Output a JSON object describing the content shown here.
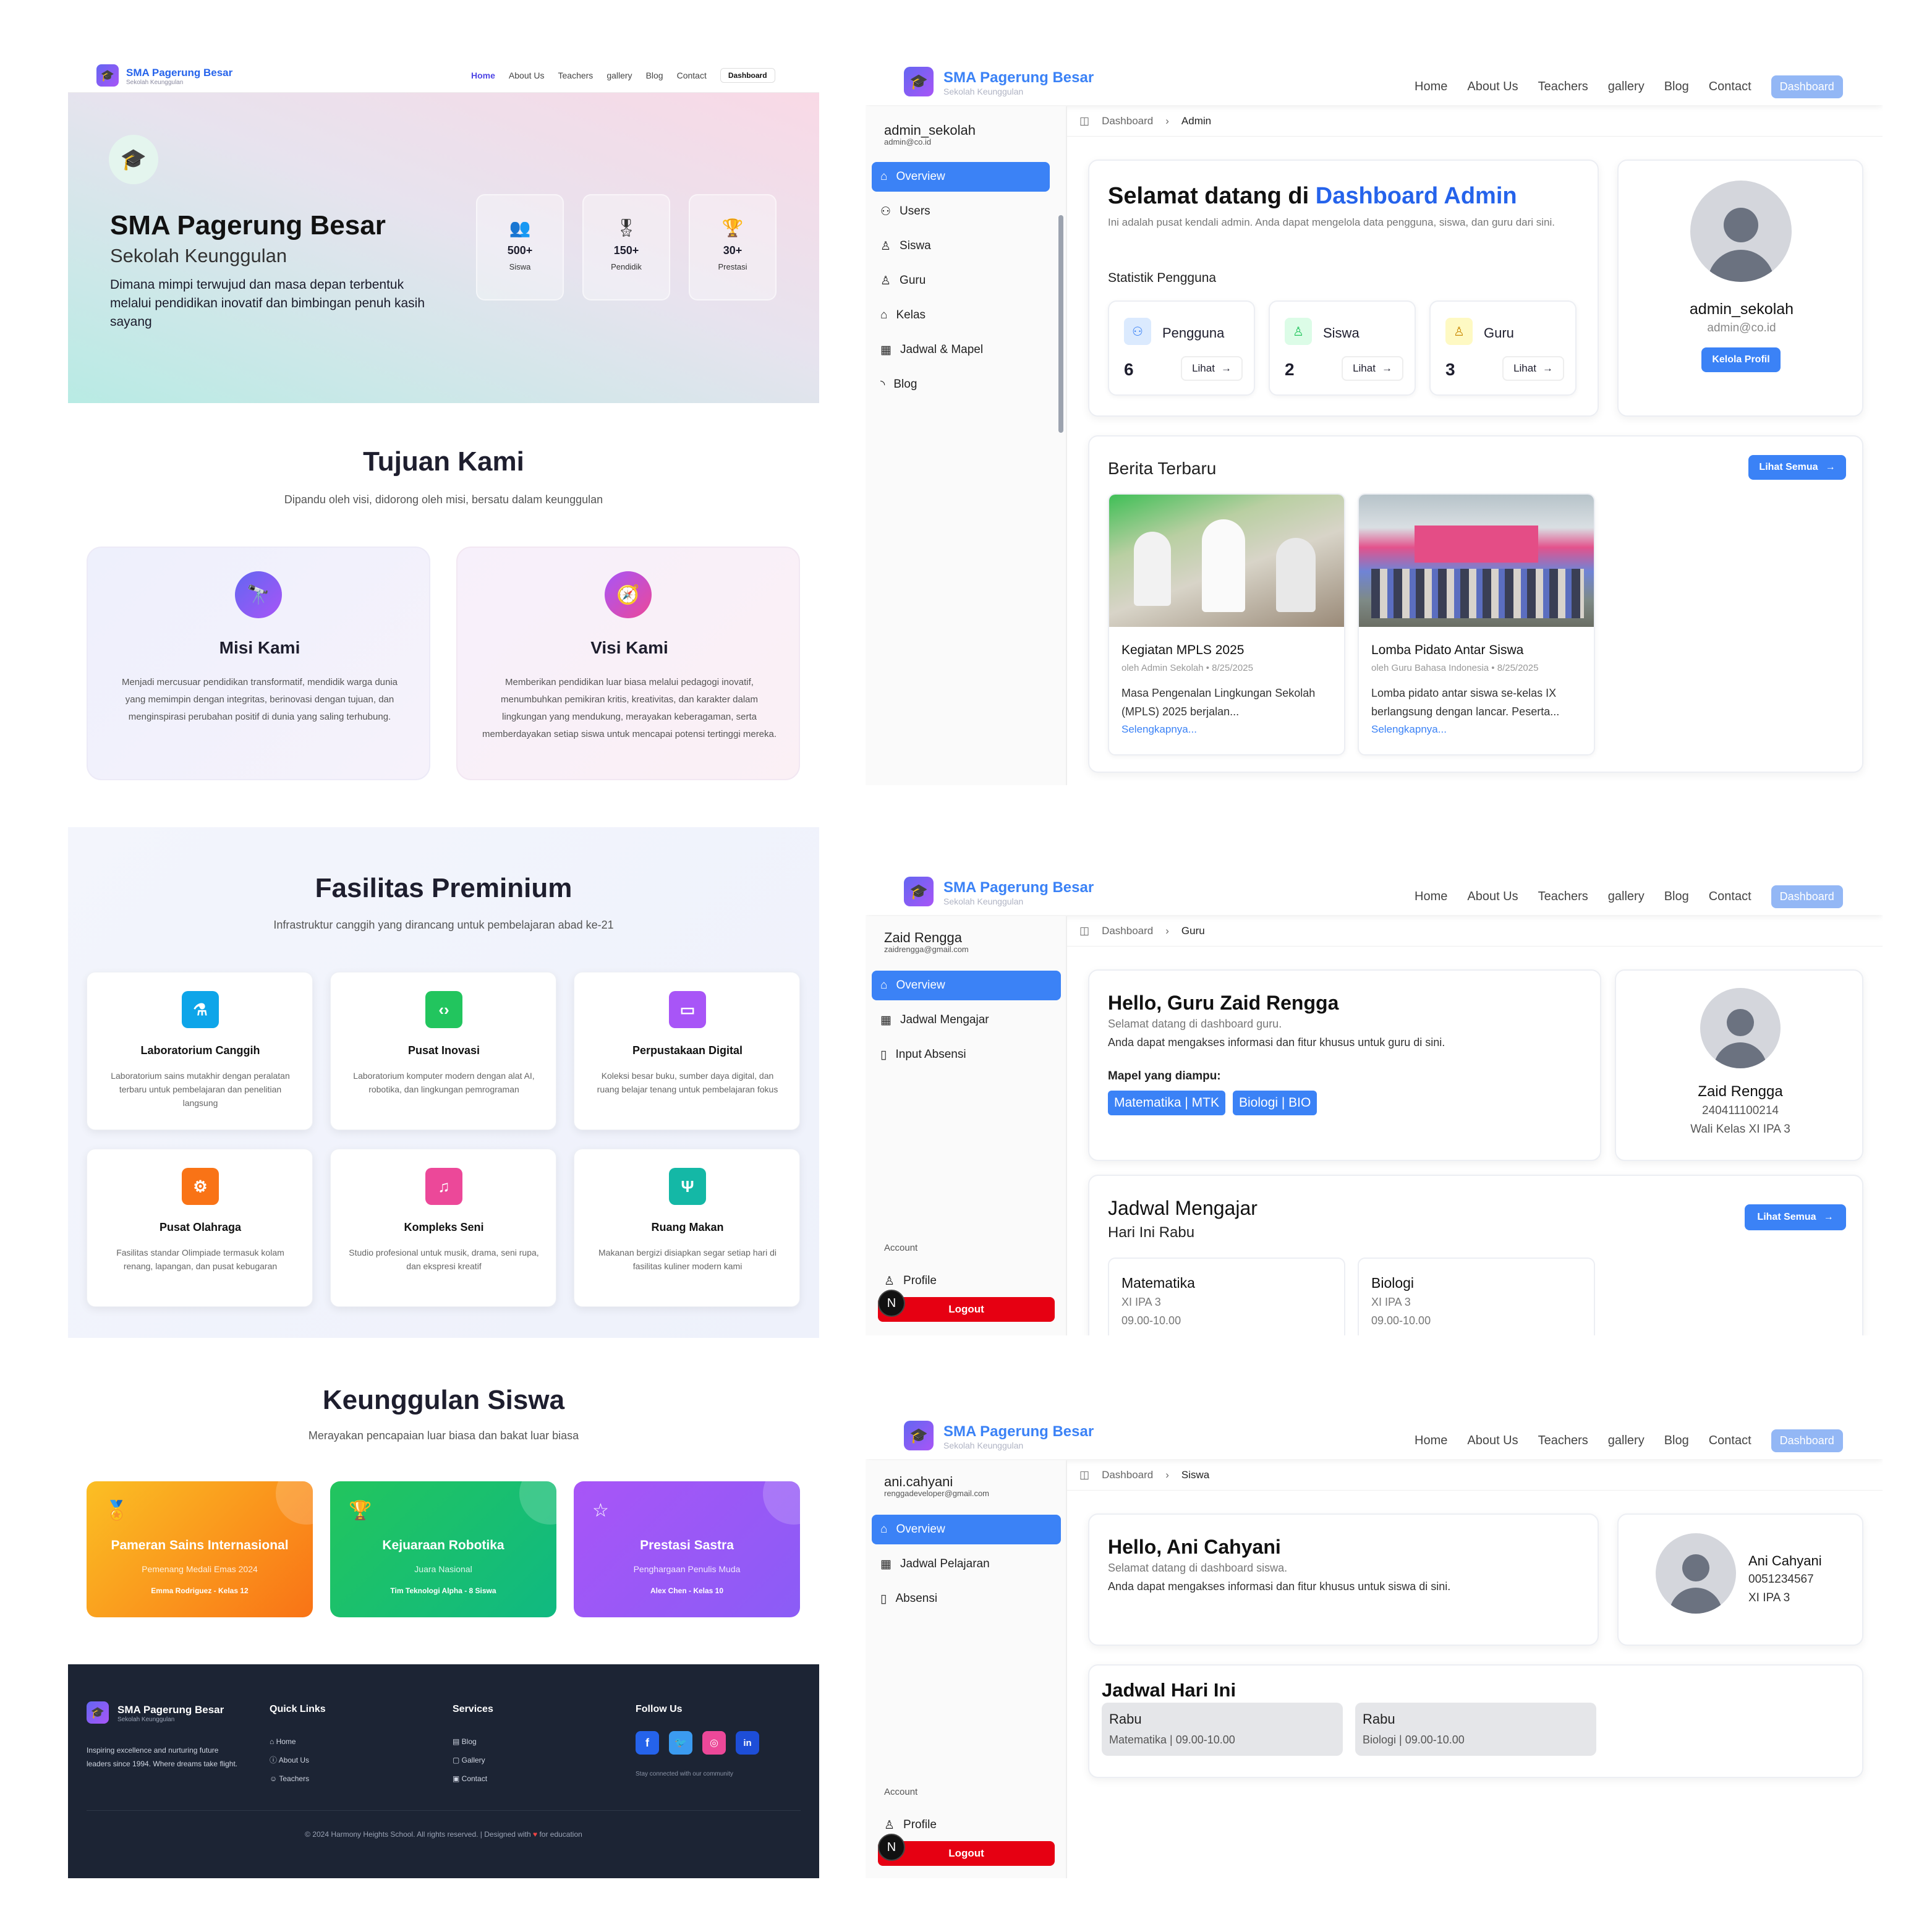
{
  "brand": {
    "name": "SMA Pagerung Besar",
    "tagline": "Sekolah Keunggulan"
  },
  "nav": {
    "home": "Home",
    "about": "About Us",
    "teachers": "Teachers",
    "gallery": "gallery",
    "blog": "Blog",
    "contact": "Contact",
    "dashboard": "Dashboard"
  },
  "landing": {
    "hero": {
      "title": "SMA Pagerung Besar",
      "subtitle": "Sekolah Keunggulan",
      "desc": "Dimana mimpi terwujud dan masa depan terbentuk melalui pendidikan inovatif dan bimbingan penuh kasih sayang",
      "stats": [
        {
          "value": "500+",
          "label": "Siswa",
          "icon": "users-icon"
        },
        {
          "value": "150+",
          "label": "Pendidik",
          "icon": "award-icon"
        },
        {
          "value": "30+",
          "label": "Prestasi",
          "icon": "trophy-icon"
        }
      ]
    },
    "goals": {
      "title": "Tujuan Kami",
      "subtitle": "Dipandu oleh visi, didorong oleh misi, bersatu dalam keunggulan",
      "cards": [
        {
          "title": "Misi Kami",
          "text": "Menjadi mercusuar pendidikan transformatif, mendidik warga dunia yang memimpin dengan integritas, berinovasi dengan tujuan, dan menginspirasi perubahan positif di dunia yang saling terhubung."
        },
        {
          "title": "Visi Kami",
          "text": "Memberikan pendidikan luar biasa melalui pedagogi inovatif, menumbuhkan pemikiran kritis, kreativitas, dan karakter dalam lingkungan yang mendukung, merayakan keberagaman, serta memberdayakan setiap siswa untuk mencapai potensi tertinggi mereka."
        }
      ]
    },
    "facilities": {
      "title": "Fasilitas Preminium",
      "subtitle": "Infrastruktur canggih yang dirancang untuk pembelajaran abad ke-21",
      "items": [
        {
          "title": "Laboratorium Canggih",
          "text": "Laboratorium sains mutakhir dengan peralatan terbaru untuk pembelajaran dan penelitian langsung",
          "color": "#0ea5e9",
          "glyph": "⚗"
        },
        {
          "title": "Pusat Inovasi",
          "text": "Laboratorium komputer modern dengan alat AI, robotika, dan lingkungan pemrograman",
          "color": "#22c55e",
          "glyph": "‹›"
        },
        {
          "title": "Perpustakaan Digital",
          "text": "Koleksi besar buku, sumber daya digital, dan ruang belajar tenang untuk pembelajaran fokus",
          "color": "#a855f7",
          "glyph": "▭"
        },
        {
          "title": "Pusat Olahraga",
          "text": "Fasilitas standar Olimpiade termasuk kolam renang, lapangan, dan pusat kebugaran",
          "color": "#f97316",
          "glyph": "⚙"
        },
        {
          "title": "Kompleks Seni",
          "text": "Studio profesional untuk musik, drama, seni rupa, dan ekspresi kreatif",
          "color": "#ec4899",
          "glyph": "♫"
        },
        {
          "title": "Ruang Makan",
          "text": "Makanan bergizi disiapkan segar setiap hari di fasilitas kuliner modern kami",
          "color": "#14b8a6",
          "glyph": "Ψ"
        }
      ]
    },
    "excellence": {
      "title": "Keunggulan Siswa",
      "subtitle": "Merayakan pencapaian luar biasa dan bakat luar biasa",
      "cards": [
        {
          "title": "Pameran Sains Internasional",
          "sub": "Pemenang Medali Emas 2024",
          "who": "Emma Rodriguez - Kelas 12",
          "from": "#fbbf24",
          "to": "#f97316"
        },
        {
          "title": "Kejuaraan Robotika",
          "sub": "Juara Nasional",
          "who": "Tim Teknologi Alpha - 8 Siswa",
          "from": "#22c55e",
          "to": "#10b981"
        },
        {
          "title": "Prestasi Sastra",
          "sub": "Penghargaan Penulis Muda",
          "who": "Alex Chen - Kelas 10",
          "from": "#a855f7",
          "to": "#8b5cf6"
        }
      ]
    },
    "footer": {
      "desc1": "Inspiring excellence and nurturing future",
      "desc2": "leaders since 1994. Where dreams take flight.",
      "quick_title": "Quick Links",
      "quick": [
        "Home",
        "About Us",
        "Teachers"
      ],
      "services_title": "Services",
      "services": [
        "Blog",
        "Gallery",
        "Contact"
      ],
      "follow_title": "Follow Us",
      "follow_note": "Stay connected with our community",
      "copyright_pre": "© 2024 Harmony Heights School. All rights reserved. | Designed with",
      "copyright_post": "for education",
      "heart_color": "#ef4444"
    }
  },
  "breadcrumb_root": "Dashboard",
  "admin": {
    "user": "admin_sekolah",
    "email": "admin@co.id",
    "crumb": "Admin",
    "menu": [
      "Overview",
      "Users",
      "Siswa",
      "Guru",
      "Kelas",
      "Jadwal & Mapel",
      "Blog"
    ],
    "welcome_pre": "Selamat datang di ",
    "welcome_hl": "Dashboard Admin",
    "welcome_desc": "Ini adalah pusat kendali admin. Anda dapat mengelola data pengguna, siswa, dan guru dari sini.",
    "stats_title": "Statistik Pengguna",
    "stats": [
      {
        "label": "Pengguna",
        "value": "6",
        "bg": "#dbeafe",
        "fg": "#3b82f6"
      },
      {
        "label": "Siswa",
        "value": "2",
        "bg": "#dcfce7",
        "fg": "#22c55e"
      },
      {
        "label": "Guru",
        "value": "3",
        "bg": "#fef9c3",
        "fg": "#ca8a04"
      }
    ],
    "lihat": "Lihat",
    "profile_button": "Kelola Profil",
    "news_title": "Berita Terbaru",
    "see_all": "Lihat Semua",
    "news": [
      {
        "title": "Kegiatan MPLS 2025",
        "meta": "oleh Admin Sekolah • 8/25/2025",
        "text": "Masa Pengenalan Lingkungan Sekolah (MPLS) 2025 berjalan...",
        "more": "Selengkapnya..."
      },
      {
        "title": "Lomba Pidato Antar Siswa",
        "meta": "oleh Guru Bahasa Indonesia • 8/25/2025",
        "text": "Lomba pidato antar siswa se-kelas IX berlangsung dengan lancar. Peserta...",
        "more": "Selengkapnya..."
      }
    ]
  },
  "guru": {
    "user": "Zaid Rengga",
    "email": "zaidrengga@gmail.com",
    "crumb": "Guru",
    "menu": [
      "Overview",
      "Jadwal Mengajar",
      "Input Absensi"
    ],
    "account": "Account",
    "profile": "Profile",
    "logout": "Logout",
    "hello": "Hello, Guru Zaid Rengga",
    "line1": "Selamat datang di dashboard guru.",
    "line2": "Anda dapat mengakses informasi dan fitur khusus untuk guru di sini.",
    "mapel_title": "Mapel yang diampu:",
    "mapel": [
      "Matematika | MTK",
      "Biologi | BIO"
    ],
    "nip": "240411100214",
    "wali": "Wali Kelas XI IPA 3",
    "schedule_title": "Jadwal Mengajar",
    "schedule_day": "Hari Ini Rabu",
    "see_all": "Lihat Semua",
    "schedule": [
      {
        "subject": "Matematika",
        "class": "XI IPA 3",
        "time": "09.00-10.00"
      },
      {
        "subject": "Biologi",
        "class": "XI IPA 3",
        "time": "09.00-10.00"
      }
    ]
  },
  "siswa": {
    "user": "ani.cahyani",
    "email": "renggadeveloper@gmail.com",
    "crumb": "Siswa",
    "menu": [
      "Overview",
      "Jadwal Pelajaran",
      "Absensi"
    ],
    "account": "Account",
    "profile": "Profile",
    "logout": "Logout",
    "hello": "Hello, Ani Cahyani",
    "line1": "Selamat datang di dashboard siswa.",
    "line2": "Anda dapat mengakses informasi dan fitur khusus untuk siswa di sini.",
    "name": "Ani Cahyani",
    "nisn": "0051234567",
    "kelas": "XI IPA 3",
    "today_title": "Jadwal Hari Ini",
    "today": [
      {
        "day": "Rabu",
        "info": "Matematika | 09.00-10.00"
      },
      {
        "day": "Rabu",
        "info": "Biologi | 09.00-10.00"
      }
    ]
  }
}
